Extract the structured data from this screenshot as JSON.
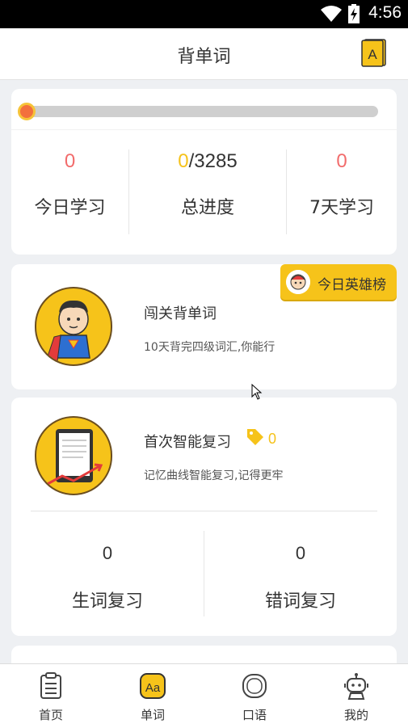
{
  "status_bar": {
    "time": "4:56"
  },
  "header": {
    "title": "背单词",
    "book_letter": "A"
  },
  "progress": {
    "stats": [
      {
        "value": "0",
        "label": "今日学习"
      },
      {
        "done": "0",
        "total": "/3285",
        "label": "总进度"
      },
      {
        "value": "0",
        "label": "7天学习"
      }
    ]
  },
  "challenge": {
    "title": "闯关背单词",
    "subtitle": "10天背完四级词汇,你能行",
    "badge": "今日英雄榜"
  },
  "review": {
    "title": "首次智能复习",
    "tag_count": "0",
    "subtitle": "记忆曲线智能复习,记得更牢",
    "items": [
      {
        "value": "0",
        "label": "生词复习"
      },
      {
        "value": "0",
        "label": "错词复习"
      }
    ]
  },
  "nav": {
    "items": [
      {
        "label": "首页",
        "icon": "clipboard-icon"
      },
      {
        "label": "单词",
        "icon": "aa-icon",
        "active": true
      },
      {
        "label": "口语",
        "icon": "speech-icon"
      },
      {
        "label": "我的",
        "icon": "robot-icon"
      }
    ]
  },
  "colors": {
    "accent": "#f6c31a",
    "red": "#f26c6c",
    "orange": "#f3703d"
  }
}
